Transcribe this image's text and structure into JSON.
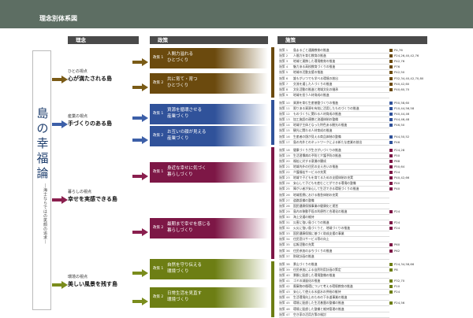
{
  "header": {
    "title": "理念別体系図"
  },
  "columns": {
    "rinen": "理念",
    "seisaku": "政策",
    "shisaku": "施策"
  },
  "vertical": {
    "title": "島の幸福論",
    "subtitle": "―海士ならではの笑顔の追求―"
  },
  "themes": [
    {
      "small": "ひとの視点",
      "big": "心が満たされる島",
      "color": "#7a5b16"
    },
    {
      "small": "産業の視点",
      "big": "手づくりのある島",
      "color": "#3c5fa8"
    },
    {
      "small": "暮らしの視点",
      "big": "幸せを実感できる島",
      "color": "#8a1f4e"
    },
    {
      "small": "環境の視点",
      "big": "美しい風景を残す島",
      "color": "#7a8c1c"
    }
  ],
  "policies": [
    {
      "num": "政策 1",
      "name": "人間力溢れる\nひとづくり",
      "color": "#6b4a0e"
    },
    {
      "num": "政策 2",
      "name": "共に育て・育つ\nひとづくり",
      "color": "#6b4a0e"
    },
    {
      "num": "政策 1",
      "name": "資源を循環させる\n産業づくり",
      "color": "#30529a"
    },
    {
      "num": "政策 2",
      "name": "お互いの顔が見える\n産業づくり",
      "color": "#30529a"
    },
    {
      "num": "政策 1",
      "name": "身近な幸せに気づく\n暮らしづくり",
      "color": "#7d1746"
    },
    {
      "num": "政策 2",
      "name": "最期まで幸せを感じる\n暮らしづくり",
      "color": "#7d1746"
    },
    {
      "num": "政策 1",
      "name": "自然を守り伝える\n環境づくり",
      "color": "#6d7e14"
    },
    {
      "num": "政策 2",
      "name": "日常生活を見直す\n環境づくり",
      "color": "#6d7e14"
    }
  ],
  "items": [
    {
      "code": "施策 1",
      "text": "島まるごと通識教育の推進",
      "page": "P4,76"
    },
    {
      "code": "施策 2",
      "text": "人間力を育む教育の推進",
      "page": "P24,26,40,42,76"
    },
    {
      "code": "施策 3",
      "text": "地域と連携した環境教育の推進",
      "page": "P42,76"
    },
    {
      "code": "施策 4",
      "text": "魅力ある高校教育づくりの推進",
      "page": "P76"
    },
    {
      "code": "施策 5",
      "text": "地域の活動支援の推進",
      "page": "P42,50"
    },
    {
      "code": "施策 6",
      "text": "誰もがいつでも学べる環境の創出",
      "page": "P32,34,40,42,70,80"
    },
    {
      "code": "施策 7",
      "text": "交流を通した人づくりの推進",
      "page": "P40,42,60"
    },
    {
      "code": "施策 8",
      "text": "文化活動の推進と地域文化の継承",
      "page": "P40,60,70"
    },
    {
      "code": "施策 9",
      "text": "地域を担う人材育成の推進",
      "page": ""
    },
    {
      "code": "施策 10",
      "text": "資源を育む生産基盤づくりの推進",
      "page": "P50,58,60"
    },
    {
      "code": "施策 11",
      "text": "限りある資源を有効に活用したものづくりの推進",
      "page": "P10,44,56,58"
    },
    {
      "code": "施策 12",
      "text": "ものづくりに関わる人材育成の推進",
      "page": "P40,44,46"
    },
    {
      "code": "施策 13",
      "text": "加工施設の連携と流通体制の整備",
      "page": "P44,46,48"
    },
    {
      "code": "施策 14",
      "text": "地域が主体となった特色ある観光の推進",
      "page": "P46,50"
    },
    {
      "code": "施策 15",
      "text": "観光に関わる人材育成の推進",
      "page": ""
    },
    {
      "code": "施策 16",
      "text": "生産者の顔が見える商品体制の整備",
      "page": "P44,50,52"
    },
    {
      "code": "施策 17",
      "text": "島の内外とのネットワークによる新たな産業の創出",
      "page": "P46"
    },
    {
      "code": "施策 18",
      "text": "健康づくりが生きがいづくりの推進",
      "page": "P24,28"
    },
    {
      "code": "施策 19",
      "text": "生活習慣病の予防と介護予防の推進",
      "page": "P50"
    },
    {
      "code": "施策 20",
      "text": "福祉に対する意識の醸成",
      "page": "P68"
    },
    {
      "code": "施策 21",
      "text": "地域内外の住民の支え合いの推進",
      "page": "P50,64"
    },
    {
      "code": "施策 22",
      "text": "介護福祉サービスの充実",
      "page": "P24"
    },
    {
      "code": "施策 23",
      "text": "地域で子どもを育てるための支援体制の充実",
      "page": "P40,42,66"
    },
    {
      "code": "施策 24",
      "text": "安心して子どもを産むことができる環境の整備",
      "page": "P40"
    },
    {
      "code": "施策 25",
      "text": "障がい者が安心して生活できる環境づくりの推進",
      "page": "P40"
    },
    {
      "code": "施策 26",
      "text": "地域医療における救急体制の充実",
      "page": ""
    },
    {
      "code": "施策 27",
      "text": "道路設備の整備",
      "page": ""
    },
    {
      "code": "施策 28",
      "text": "国民健康保険事業の健康化と運営",
      "page": ""
    },
    {
      "code": "施策 29",
      "text": "島内の移動手段の利便性と合理化の推進",
      "page": "P24"
    },
    {
      "code": "施策 30",
      "text": "海上交通の維持",
      "page": ""
    },
    {
      "code": "施策 31",
      "text": "災害に強い島づくりの推進",
      "page": "P24"
    },
    {
      "code": "施策 32",
      "text": "火災に強い島づくりと、地域づくりの推進",
      "page": "P24"
    },
    {
      "code": "施策 33",
      "text": "国民健康保険に基づく助成支援の事業",
      "page": ""
    },
    {
      "code": "施策 34",
      "text": "住民窓口サービス等の向上",
      "page": ""
    },
    {
      "code": "施策 35",
      "text": "広報活動の充実",
      "page": "P60"
    },
    {
      "code": "施策 36",
      "text": "住民参加のまちづくりの推進",
      "page": "P62"
    },
    {
      "code": "施策 37",
      "text": "財政計画の推進",
      "page": ""
    },
    {
      "code": "施策 38",
      "text": "景山づくりの推進",
      "page": "P24,34,58,66"
    },
    {
      "code": "施策 39",
      "text": "住民参加による自然利用計画の策定",
      "page": "P8"
    },
    {
      "code": "施策 40",
      "text": "景観に配慮した環境整備の推進",
      "page": ""
    },
    {
      "code": "施策 41",
      "text": "ゴミの減量化の推進",
      "page": "P32,70"
    },
    {
      "code": "施策 42",
      "text": "廃棄物の循環について考える環境教育の推進",
      "page": "P10"
    },
    {
      "code": "施策 43",
      "text": "安心して使える水道水の供給の維持",
      "page": "P24"
    },
    {
      "code": "施策 44",
      "text": "生活環境向上のための下水道事業の推進",
      "page": ""
    },
    {
      "code": "施策 45",
      "text": "環境に配慮した生活基盤の整備の推進",
      "page": "P24,56"
    },
    {
      "code": "施策 46",
      "text": "環境に配慮した整備と維持管理の推進",
      "page": ""
    },
    {
      "code": "施策 47",
      "text": "空き家の活用方策の検討",
      "page": ""
    }
  ]
}
